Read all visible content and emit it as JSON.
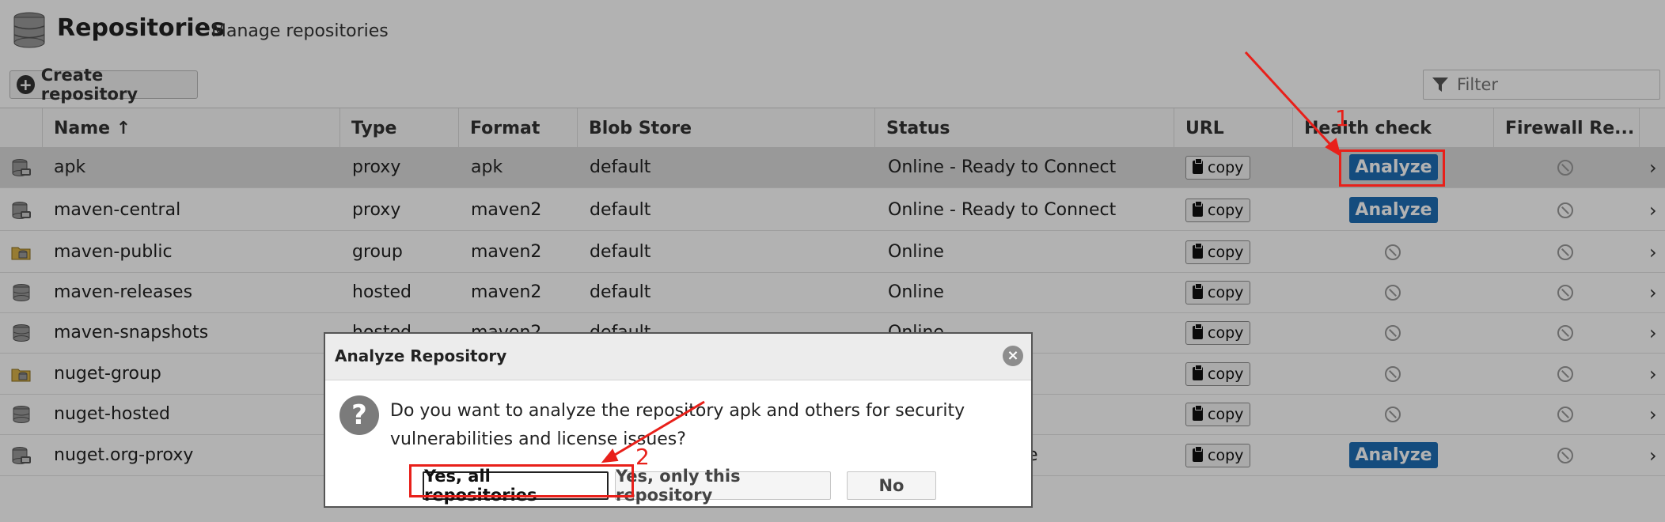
{
  "header": {
    "title": "Repositories",
    "subtitle": "Manage repositories"
  },
  "toolbar": {
    "create_label": "Create repository",
    "filter_placeholder": "Filter"
  },
  "columns": {
    "name": "Name ↑",
    "type": "Type",
    "format": "Format",
    "blob_store": "Blob Store",
    "status": "Status",
    "url": "URL",
    "health_check": "Health check",
    "firewall": "Firewall Re..."
  },
  "rows": [
    {
      "name": "apk",
      "type": "proxy",
      "format": "apk",
      "blob": "default",
      "status": "Online - Ready to Connect",
      "copy": "copy",
      "health": "Analyze",
      "icon": "proxy-repo-icon"
    },
    {
      "name": "maven-central",
      "type": "proxy",
      "format": "maven2",
      "blob": "default",
      "status": "Online - Ready to Connect",
      "copy": "copy",
      "health": "Analyze",
      "icon": "proxy-repo-icon"
    },
    {
      "name": "maven-public",
      "type": "group",
      "format": "maven2",
      "blob": "default",
      "status": "Online",
      "copy": "copy",
      "health": "",
      "icon": "group-repo-icon"
    },
    {
      "name": "maven-releases",
      "type": "hosted",
      "format": "maven2",
      "blob": "default",
      "status": "Online",
      "copy": "copy",
      "health": "",
      "icon": "hosted-repo-icon"
    },
    {
      "name": "maven-snapshots",
      "type": "hosted",
      "format": "maven2",
      "blob": "default",
      "status": "Online",
      "copy": "copy",
      "health": "",
      "icon": "hosted-repo-icon"
    },
    {
      "name": "nuget-group",
      "type": "",
      "format": "",
      "blob": "",
      "status": "",
      "copy": "copy",
      "health": "",
      "icon": "group-repo-icon"
    },
    {
      "name": "nuget-hosted",
      "type": "",
      "format": "",
      "blob": "",
      "status": "",
      "copy": "copy",
      "health": "",
      "icon": "hosted-repo-icon"
    },
    {
      "name": "nuget.org-proxy",
      "type": "",
      "format": "",
      "blob": "",
      "status": "Available",
      "copy": "copy",
      "health": "Analyze",
      "icon": "proxy-repo-icon"
    }
  ],
  "dialog": {
    "title": "Analyze Repository",
    "close_icon": "close-icon",
    "message": "Do you want to analyze the repository apk and others for security vulnerabilities and license issues?",
    "btn_all": "Yes, all repositories",
    "btn_only": "Yes, only this repository",
    "btn_no": "No"
  },
  "annotations": {
    "step1": "1",
    "step2": "2",
    "color": "#e8201a"
  },
  "colors": {
    "accent": "#1e6eb5",
    "selected_row": "#dcdcdc"
  }
}
